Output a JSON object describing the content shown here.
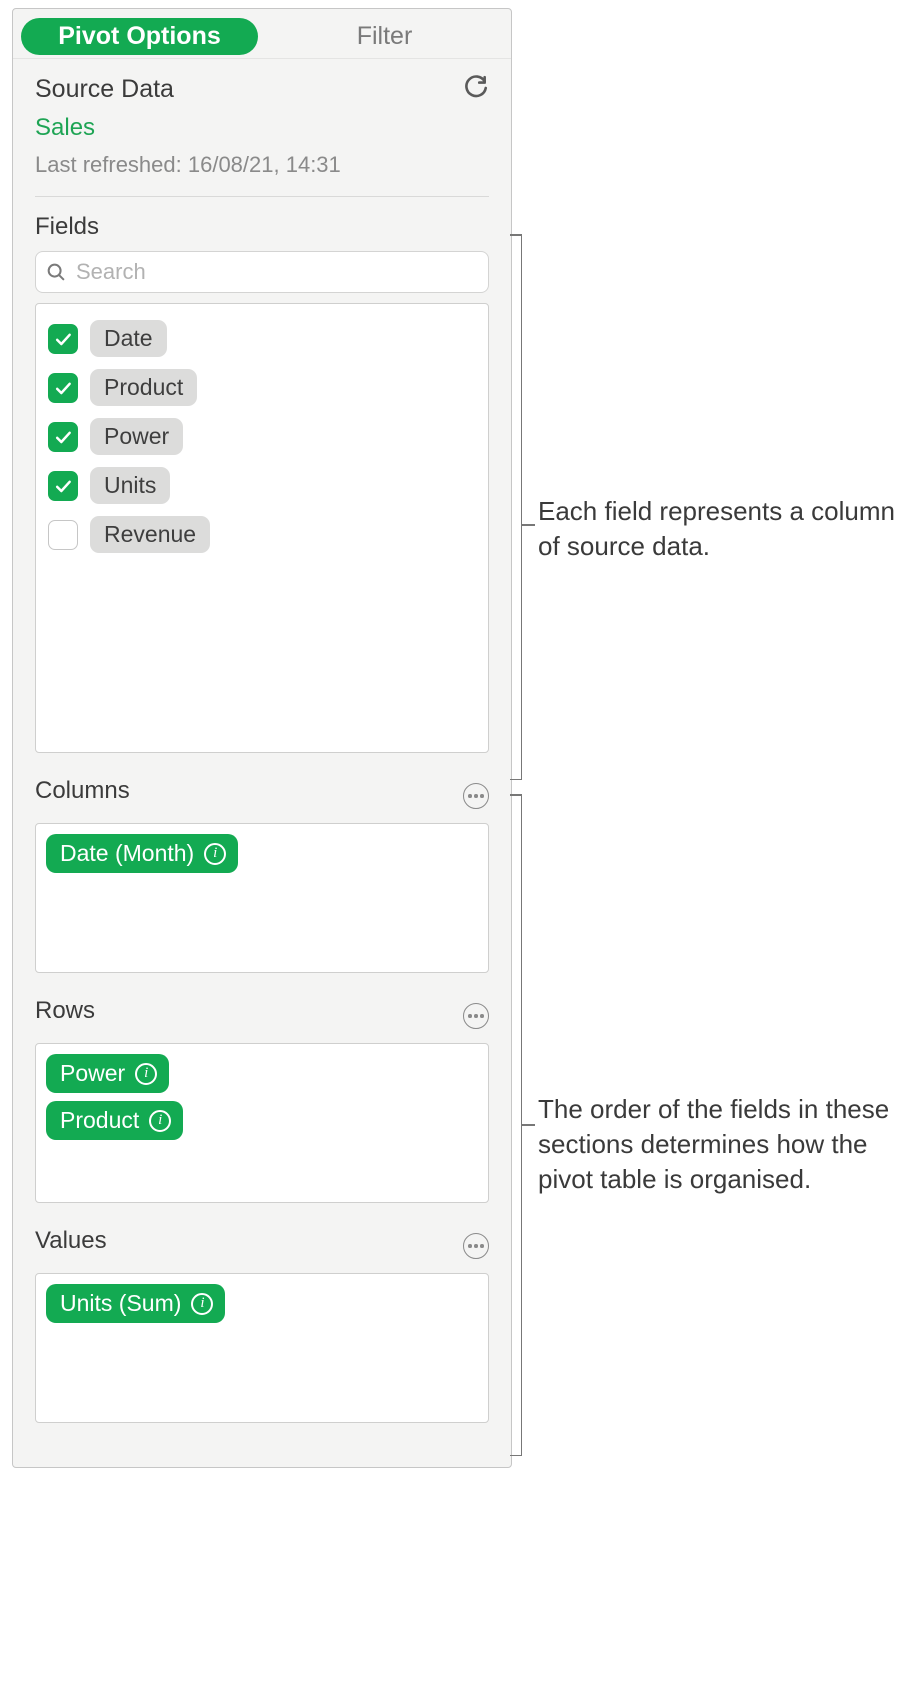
{
  "tabs": {
    "pivot": "Pivot Options",
    "filter": "Filter"
  },
  "source": {
    "label": "Source Data",
    "name": "Sales",
    "last_refreshed": "Last refreshed: 16/08/21, 14:31"
  },
  "fields": {
    "label": "Fields",
    "search_placeholder": "Search",
    "items": [
      {
        "label": "Date",
        "checked": true
      },
      {
        "label": "Product",
        "checked": true
      },
      {
        "label": "Power",
        "checked": true
      },
      {
        "label": "Units",
        "checked": true
      },
      {
        "label": "Revenue",
        "checked": false
      }
    ]
  },
  "columns": {
    "label": "Columns",
    "items": [
      {
        "label": "Date (Month)"
      }
    ]
  },
  "rows": {
    "label": "Rows",
    "items": [
      {
        "label": "Power"
      },
      {
        "label": "Product"
      }
    ]
  },
  "values": {
    "label": "Values",
    "items": [
      {
        "label": "Units (Sum)"
      }
    ]
  },
  "callouts": {
    "fields": "Each field represents a column of source data.",
    "sections": "The order of the fields in these sections determines how the pivot table is organised."
  }
}
